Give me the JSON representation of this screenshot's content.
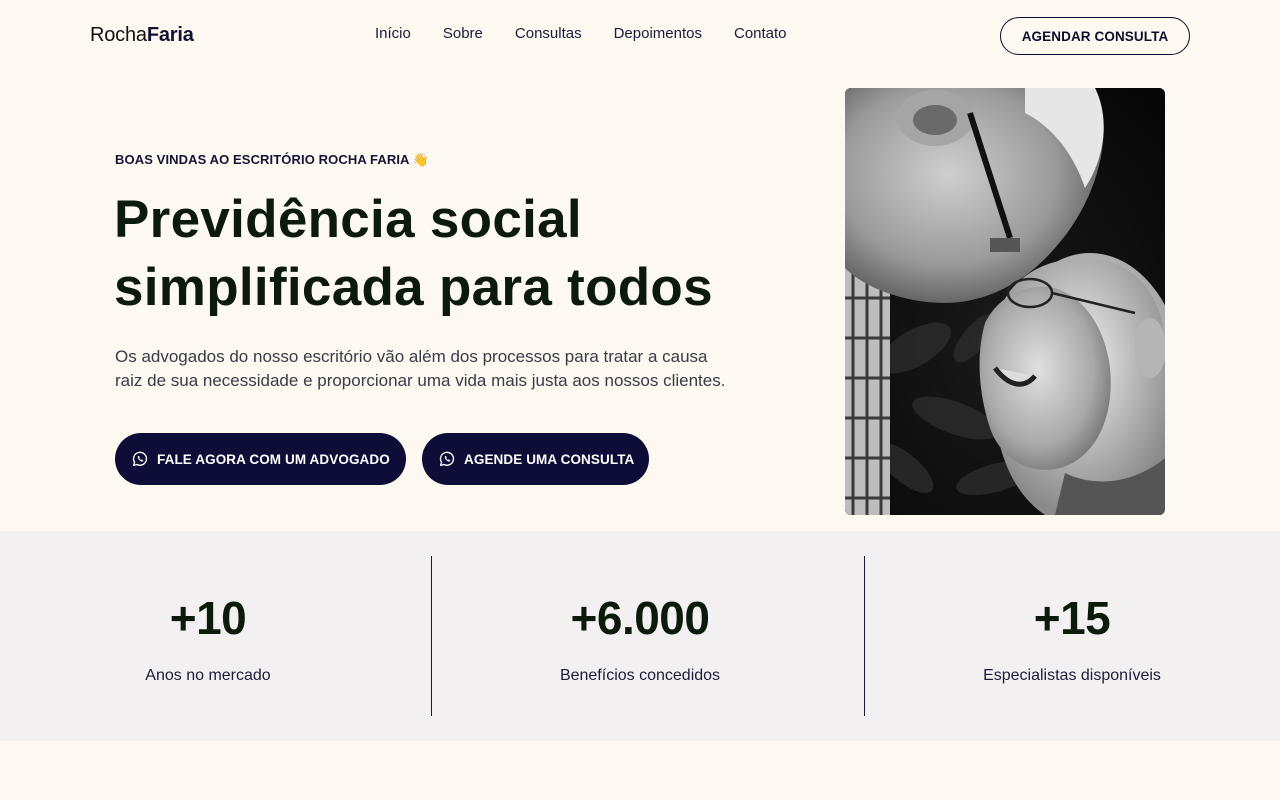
{
  "header": {
    "logo_regular": "Rocha",
    "logo_bold": "Faria",
    "nav": [
      "Início",
      "Sobre",
      "Consultas",
      "Depoimentos",
      "Contato"
    ],
    "cta_label": "AGENDAR CONSULTA"
  },
  "hero": {
    "eyebrow": "BOAS VINDAS AO ESCRITÓRIO ROCHA FARIA 👋",
    "title": "Previdência social simplificada para todos",
    "description": "Os advogados do nosso escritório vão além dos processos para tratar a causa raiz de sua necessidade e proporcionar uma vida mais justa aos nossos clientes.",
    "button_primary": "FALE AGORA COM UM ADVOGADO",
    "button_secondary": "AGENDE UMA CONSULTA",
    "button_icon": "whatsapp-icon"
  },
  "stats": [
    {
      "value": "+10",
      "label": "Anos no mercado"
    },
    {
      "value": "+6.000",
      "label": "Benefícios concedidos"
    },
    {
      "value": "+15",
      "label": "Especialistas disponíveis"
    }
  ],
  "colors": {
    "background": "#fdf9f1",
    "navy": "#0d0d38",
    "stats_band": "#f2f0f0",
    "heading": "#0c1a0c"
  }
}
